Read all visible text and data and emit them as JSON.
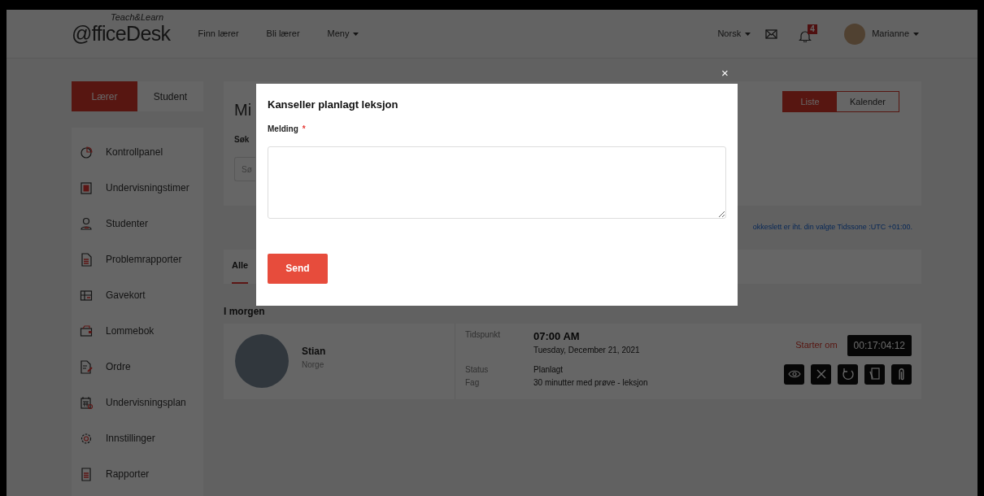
{
  "header": {
    "logo": {
      "main": "@fficeDesk",
      "tagline": "Teach&Learn"
    },
    "nav": [
      {
        "label": "Finn lærer",
        "dropdown": false
      },
      {
        "label": "Bli lærer",
        "dropdown": false
      },
      {
        "label": "Meny",
        "dropdown": true
      }
    ],
    "language": "Norsk",
    "notification_count": "4",
    "user": "Marianne"
  },
  "sidebar": {
    "role_tabs": [
      {
        "label": "Lærer",
        "selected": true
      },
      {
        "label": "Student",
        "selected": false
      }
    ],
    "items": [
      {
        "label": "Kontrollpanel"
      },
      {
        "label": "Undervisningstimer"
      },
      {
        "label": "Studenter"
      },
      {
        "label": "Problemrapporter"
      },
      {
        "label": "Gavekort"
      },
      {
        "label": "Lommebok"
      },
      {
        "label": "Ordre"
      },
      {
        "label": "Undervisningsplan"
      },
      {
        "label": "Innstillinger"
      },
      {
        "label": "Rapporter"
      }
    ]
  },
  "main": {
    "heading": "Mi",
    "view_toggle": [
      {
        "label": "Liste",
        "selected": true
      },
      {
        "label": "Kalender",
        "selected": false
      }
    ],
    "search": {
      "label": "Søk",
      "placeholder": "Sø"
    },
    "timezone_note": "okkeslett er iht. din valgte Tidssone :UTC +01:00.",
    "tabs": [
      {
        "label": "Alle",
        "selected": true
      }
    ],
    "section": "I morgen",
    "lesson": {
      "name": "Stian",
      "country": "Norge",
      "time_label": "Tidspunkt",
      "time": "07:00 AM",
      "date": "Tuesday, December 21, 2021",
      "status_label": "Status",
      "status": "Planlagt",
      "subject_label": "Fag",
      "subject": "30 minutter med prøve - leksjon",
      "countdown_label": "Starter om",
      "countdown": "00:17:04:12"
    }
  },
  "modal": {
    "close": "×",
    "title": "Kanseller planlagt leksjon",
    "field_label": "Melding",
    "required_mark": "*",
    "button": "Send"
  }
}
